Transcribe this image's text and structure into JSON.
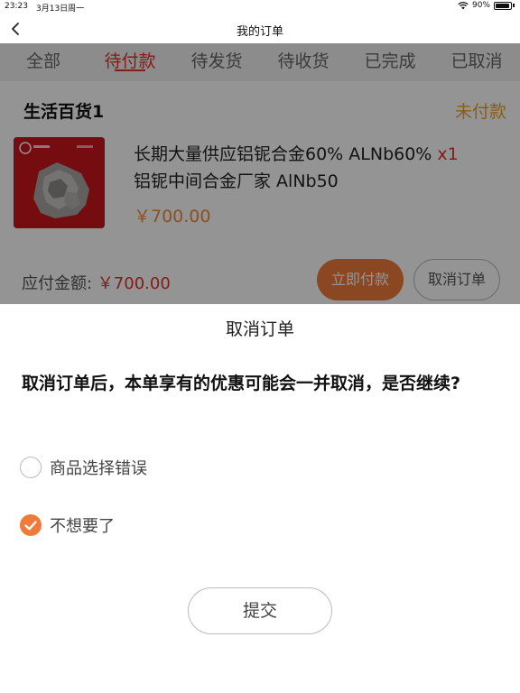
{
  "status_bar": {
    "time": "23:23",
    "date": "3月13日周一",
    "battery": "90%"
  },
  "nav": {
    "title": "我的订单"
  },
  "tabs": [
    {
      "label": "全部"
    },
    {
      "label": "待付款",
      "active": true
    },
    {
      "label": "待发货"
    },
    {
      "label": "待收货"
    },
    {
      "label": "已完成"
    },
    {
      "label": "已取消"
    }
  ],
  "order": {
    "shop_name": "生活百货1",
    "status": "未付款",
    "product_name": "长期大量供应铝铌合金60% ALNb60% ",
    "quantity": "x1",
    "product_name_line2": "铝铌中间合金厂家 AlNb50",
    "price": "￥700.00",
    "amount_label": "应付金额: ",
    "amount_value": "￥700.00",
    "pay_button": "立即付款",
    "cancel_button": "取消订单"
  },
  "cancel_sheet": {
    "title": "取消订单",
    "question": "取消订单后，本单享有的优惠可能会一并取消，是否继续?",
    "options": [
      {
        "label": "商品选择错误",
        "checked": false
      },
      {
        "label": "不想要了",
        "checked": true
      }
    ],
    "submit": "提交"
  },
  "colors": {
    "accent": "#f07a3a",
    "red": "#e0322c",
    "status_orange": "#f0a020"
  },
  "icons": {
    "back": "chevron-left-icon",
    "wifi": "wifi-icon",
    "battery": "battery-icon",
    "check": "check-icon"
  }
}
